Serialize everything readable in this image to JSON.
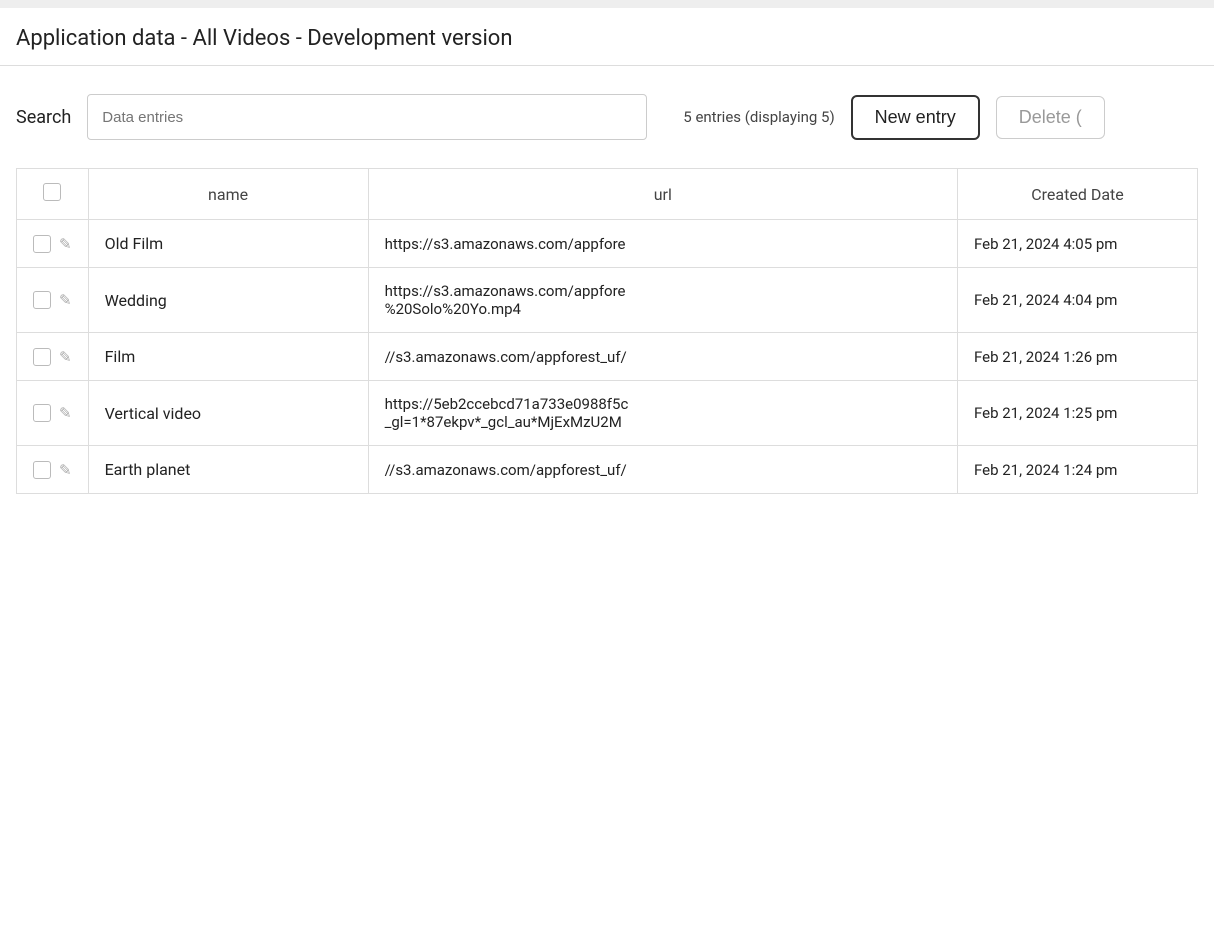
{
  "page": {
    "title": "Application data - All Videos - Development version"
  },
  "toolbar": {
    "search_label": "Search",
    "search_placeholder": "Data entries",
    "entries_info": "5 entries (displaying 5)",
    "new_entry_label": "New entry",
    "delete_label": "Delete ("
  },
  "table": {
    "headers": {
      "check": "",
      "name": "name",
      "url": "url",
      "created_date": "Created Date"
    },
    "rows": [
      {
        "id": 1,
        "name": "Old Film",
        "url": "https://s3.amazonaws.com/appfore",
        "created_date": "Feb 21, 2024 4:05 pm"
      },
      {
        "id": 2,
        "name": "Wedding",
        "url_line1": "https://s3.amazonaws.com/appfore",
        "url_line2": "%20Solo%20Yo.mp4",
        "created_date": "Feb 21, 2024 4:04 pm"
      },
      {
        "id": 3,
        "name": "Film",
        "url": "//s3.amazonaws.com/appforest_uf/",
        "created_date": "Feb 21, 2024 1:26 pm"
      },
      {
        "id": 4,
        "name": "Vertical video",
        "url_line1": "https://5eb2ccebcd71a733e0988f5c",
        "url_line2": "_gl=1*87ekpv*_gcl_au*MjExMzU2M",
        "created_date": "Feb 21, 2024 1:25 pm"
      },
      {
        "id": 5,
        "name": "Earth planet",
        "url": "//s3.amazonaws.com/appforest_uf/",
        "created_date": "Feb 21, 2024 1:24 pm"
      }
    ]
  }
}
